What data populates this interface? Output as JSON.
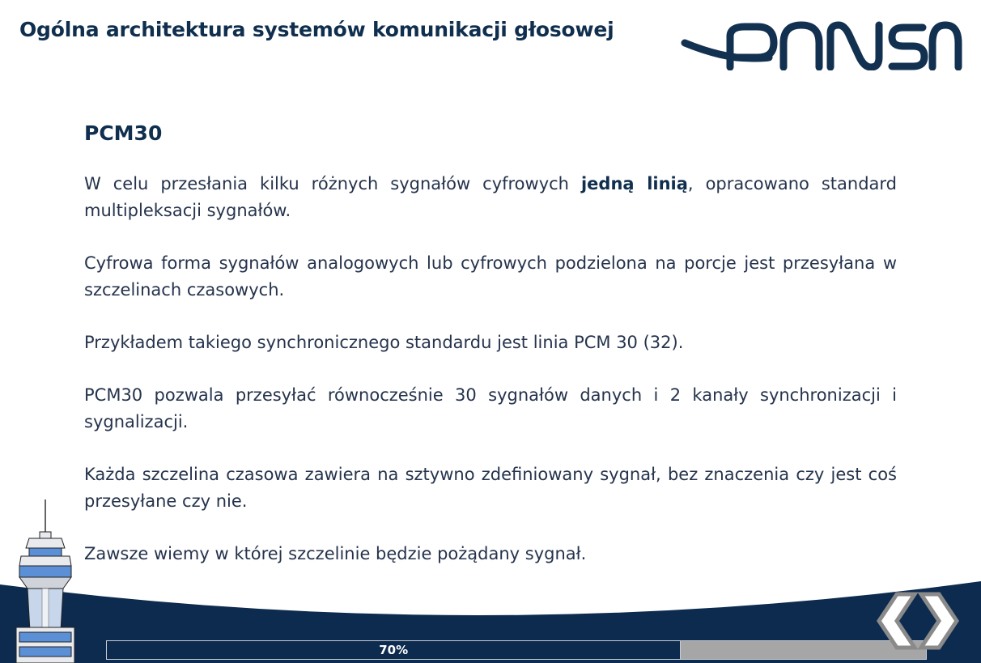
{
  "header": {
    "title": "Ogólna architektura systemów komunikacji głosowej",
    "logo_text": "PANSA"
  },
  "content": {
    "heading": "PCM30",
    "p1_before": "W celu przesłania kilku różnych sygnałów cyfrowych ",
    "p1_bold": "jedną linią",
    "p1_after": ", opracowano standard multipleksacji sygnałów.",
    "p2": "Cyfrowa forma sygnałów analogowych lub cyfrowych podzielona na porcje jest przesyłana w szczelinach czasowych.",
    "p3": "Przykładem takiego synchronicznego standardu jest linia PCM 30 (32).",
    "p4": "PCM30 pozwala przesyłać równocześnie 30 sygnałów danych i 2 kanały synchronizacji i sygnalizacji.",
    "p5": "Każda szczelina czasowa zawiera na sztywno zdefiniowany sygnał, bez znaczenia czy jest coś przesyłane czy nie.",
    "p6": "Zawsze wiemy w której szczelinie będzie pożądany sygnał."
  },
  "progress": {
    "label": "70%",
    "value": 70
  },
  "nav": {
    "prev_icon": "chevron-left-icon",
    "next_icon": "chevron-right-icon"
  },
  "colors": {
    "navy": "#0d2b4e",
    "progress_track": "#a6a6a6"
  }
}
